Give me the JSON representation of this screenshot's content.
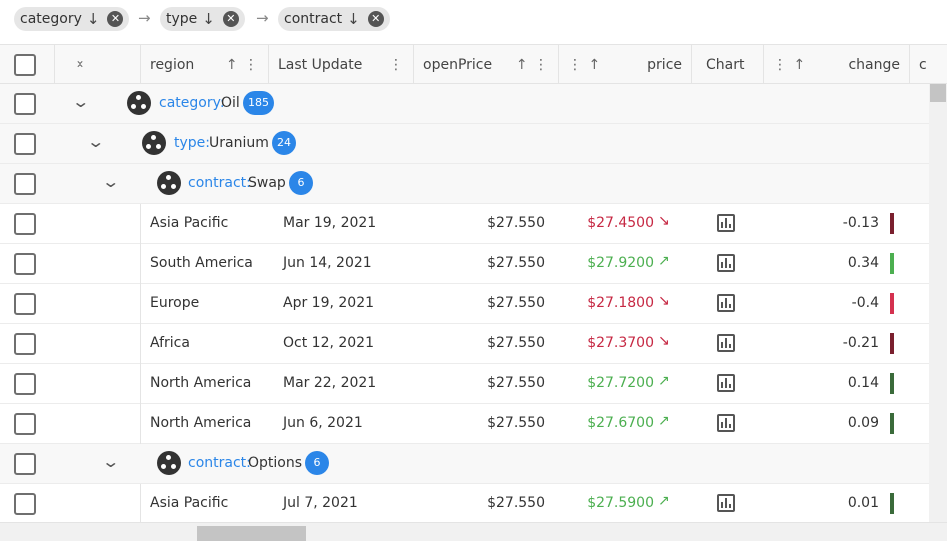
{
  "group_chips": [
    {
      "label": "category",
      "sort": "↓"
    },
    {
      "label": "type",
      "sort": "↓"
    },
    {
      "label": "contract",
      "sort": "↓"
    }
  ],
  "columns": {
    "region": "region",
    "last_update": "Last Update",
    "open_price": "openPrice",
    "price": "price",
    "chart": "Chart",
    "change": "change",
    "next_partial": "c"
  },
  "groups": {
    "category": {
      "field": "category:",
      "value": "Oil",
      "count": "185"
    },
    "type": {
      "field": "type:",
      "value": "Uranium",
      "count": "24"
    },
    "contract_swap": {
      "field": "contract:",
      "value": "Swap",
      "count": "6"
    },
    "contract_options": {
      "field": "contract:",
      "value": "Options",
      "count": "6"
    }
  },
  "rows": [
    {
      "region": "Asia Pacific",
      "last_update": "Mar 19, 2021",
      "open_price": "$27.550",
      "price": "$27.4500",
      "trend": "down",
      "change": "-0.13"
    },
    {
      "region": "South America",
      "last_update": "Jun 14, 2021",
      "open_price": "$27.550",
      "price": "$27.9200",
      "trend": "up",
      "change": "0.34"
    },
    {
      "region": "Europe",
      "last_update": "Apr 19, 2021",
      "open_price": "$27.550",
      "price": "$27.1800",
      "trend": "down",
      "change": "-0.4"
    },
    {
      "region": "Africa",
      "last_update": "Oct 12, 2021",
      "open_price": "$27.550",
      "price": "$27.3700",
      "trend": "down",
      "change": "-0.21"
    },
    {
      "region": "North America",
      "last_update": "Mar 22, 2021",
      "open_price": "$27.550",
      "price": "$27.7200",
      "trend": "up",
      "change": "0.14"
    },
    {
      "region": "North America",
      "last_update": "Jun 6, 2021",
      "open_price": "$27.550",
      "price": "$27.6700",
      "trend": "up",
      "change": "0.09"
    }
  ],
  "options_rows": [
    {
      "region": "Asia Pacific",
      "last_update": "Jul 7, 2021",
      "open_price": "$27.550",
      "price": "$27.5900",
      "trend": "up",
      "change": "0.01"
    }
  ],
  "colors": {
    "accent": "#2b86e8",
    "price_up": "#4caf50",
    "price_down": "#c62843",
    "bar_up": "#3a6b3a",
    "bar_down": "#7a1f2e",
    "bar_up_light": "#4caf50",
    "bar_down_light": "#d4314f"
  },
  "icons": {
    "sort_down": "arrow-down-icon",
    "remove": "close-icon",
    "chevron": "chevron-down-icon",
    "group": "group-icon",
    "chart": "chart-icon",
    "trend_up": "trending-up-icon",
    "trend_down": "trending-down-icon"
  }
}
